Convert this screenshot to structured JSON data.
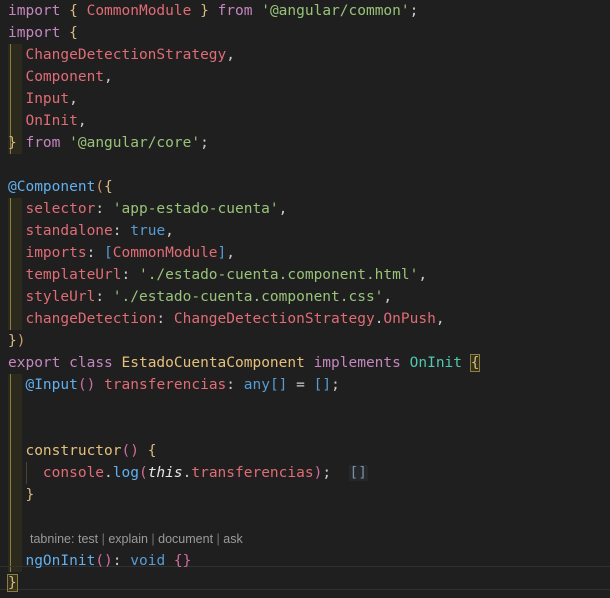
{
  "editor": {
    "language": "typescript",
    "theme": "dark",
    "background": "#1f1f1f",
    "foreground": "#cccccc",
    "font_size_px": 14.5,
    "line_height_px": 22
  },
  "colors": {
    "keyword": "#c586c0",
    "string": "#98c379",
    "property": "#e06c75",
    "class_name": "#e5c07b",
    "function": "#61afef",
    "decorator": "#61afef",
    "type": "#4ec9b0",
    "brace_yellow": "#d7ba7d",
    "paren_orange": "#d19a66",
    "bracket_blue": "#569cd6",
    "boolean": "#569cd6",
    "inline_hint": "#7d8fa3",
    "scope_guide": "#8a7f3d",
    "codelens": "#999999"
  },
  "lines": [
    {
      "n": 1,
      "text": "import { CommonModule } from '@angular/common';"
    },
    {
      "n": 2,
      "text": "import {"
    },
    {
      "n": 3,
      "text": "  ChangeDetectionStrategy,"
    },
    {
      "n": 4,
      "text": "  Component,"
    },
    {
      "n": 5,
      "text": "  Input,"
    },
    {
      "n": 6,
      "text": "  OnInit,"
    },
    {
      "n": 7,
      "text": "} from '@angular/core';"
    },
    {
      "n": 8,
      "text": ""
    },
    {
      "n": 9,
      "text": "@Component({"
    },
    {
      "n": 10,
      "text": "  selector: 'app-estado-cuenta',"
    },
    {
      "n": 11,
      "text": "  standalone: true,"
    },
    {
      "n": 12,
      "text": "  imports: [CommonModule],"
    },
    {
      "n": 13,
      "text": "  templateUrl: './estado-cuenta.component.html',"
    },
    {
      "n": 14,
      "text": "  styleUrl: './estado-cuenta.component.css',"
    },
    {
      "n": 15,
      "text": "  changeDetection: ChangeDetectionStrategy.OnPush,"
    },
    {
      "n": 16,
      "text": "})"
    },
    {
      "n": 17,
      "text": "export class EstadoCuentaComponent implements OnInit {"
    },
    {
      "n": 18,
      "text": "  @Input() transferencias: any[] = [];"
    },
    {
      "n": 19,
      "text": ""
    },
    {
      "n": 20,
      "text": ""
    },
    {
      "n": 21,
      "text": "  constructor() {"
    },
    {
      "n": 22,
      "text": "    console.log(this.transferencias);"
    },
    {
      "n": 23,
      "text": "  }"
    },
    {
      "n": 24,
      "text": ""
    },
    {
      "n": 25,
      "text": "  ngOnInit(): void {}"
    },
    {
      "n": 26,
      "text": "}"
    }
  ],
  "tokens": {
    "import": "import",
    "from": "from",
    "export": "export",
    "class": "class",
    "implements": "implements",
    "void": "void",
    "true": "true",
    "this": "this",
    "any": "any",
    "common_module": "CommonModule",
    "angular_common": "'@angular/common'",
    "angular_core": "'@angular/core'",
    "change_detection_strategy": "ChangeDetectionStrategy",
    "component": "Component",
    "input": "Input",
    "on_init": "OnInit",
    "decorator_component": "@Component",
    "decorator_input": "@Input",
    "selector_key": "selector",
    "selector_value": "'app-estado-cuenta'",
    "standalone_key": "standalone",
    "imports_key": "imports",
    "template_url_key": "templateUrl",
    "template_url_value": "'./estado-cuenta.component.html'",
    "style_url_key": "styleUrl",
    "style_url_value": "'./estado-cuenta.component.css'",
    "change_detection_key": "changeDetection",
    "on_push": "OnPush",
    "class_name": "EstadoCuentaComponent",
    "transferencias": "transferencias",
    "constructor": "constructor",
    "console": "console",
    "log": "log",
    "ng_on_init": "ngOnInit"
  },
  "inline_hints": [
    {
      "line": 22,
      "value": "[]",
      "description": "inline debug value for this.transferencias"
    }
  ],
  "codelens": {
    "line": 25,
    "prefix": "tabnine:",
    "actions": [
      "test",
      "explain",
      "document",
      "ask"
    ],
    "separator": "|",
    "full_text": "tabnine: test | explain | document | ask"
  }
}
